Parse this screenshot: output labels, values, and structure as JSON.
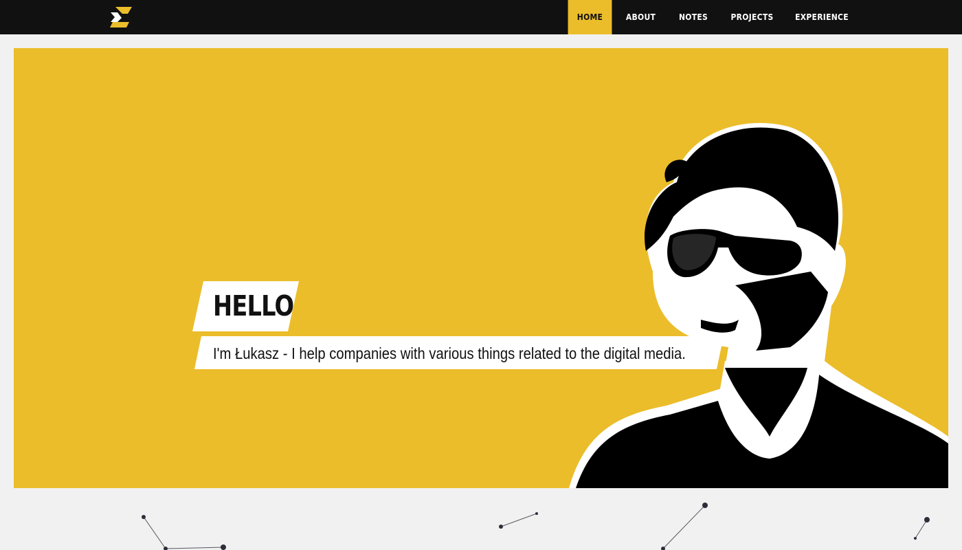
{
  "header": {
    "logo_icon": "brand-logo-icon",
    "nav": [
      {
        "label": "HOME",
        "active": true
      },
      {
        "label": "ABOUT",
        "active": false
      },
      {
        "label": "NOTES",
        "active": false
      },
      {
        "label": "PROJECTS",
        "active": false
      },
      {
        "label": "EXPERIENCE",
        "active": false
      }
    ]
  },
  "hero": {
    "heading": "HELLO",
    "tagline": "I'm Łukasz - I help companies with various things related to the digital media.",
    "illustration_icon": "portrait-illustration"
  },
  "colors": {
    "accent": "#ebbd2a",
    "topbar": "#111111",
    "background": "#f1f1f1",
    "text_dark": "#111111"
  }
}
